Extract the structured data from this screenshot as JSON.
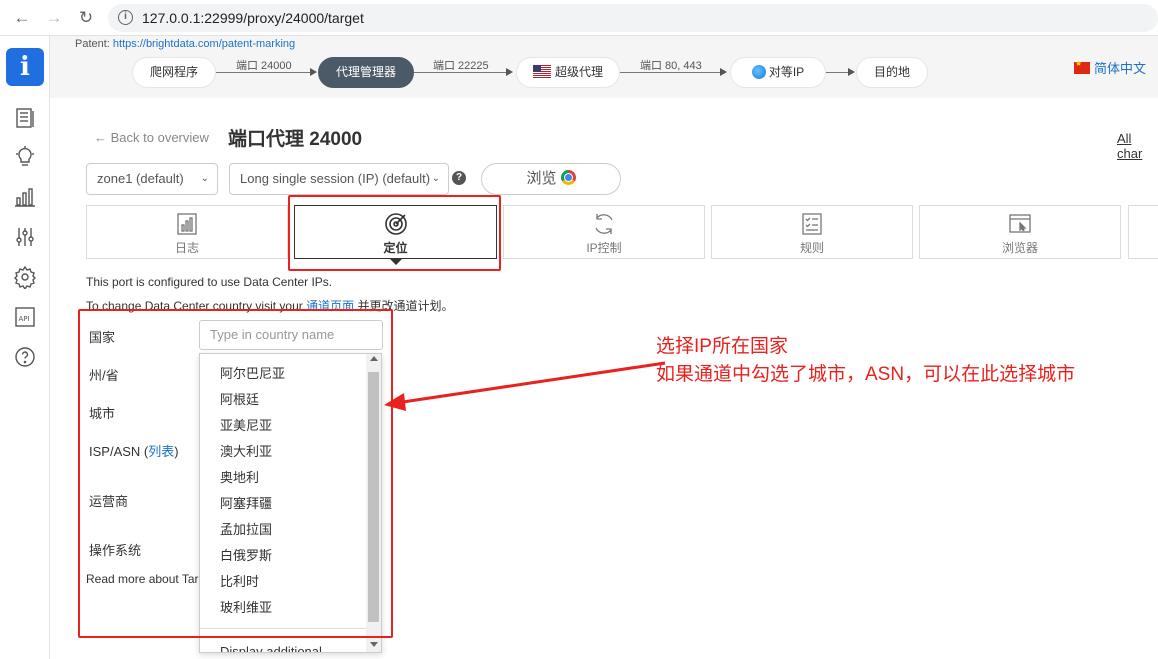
{
  "browser": {
    "url": "127.0.0.1:22999/proxy/24000/target"
  },
  "flow": {
    "patent_label": "Patent:",
    "patent_link": "https://brightdata.com/patent-marking",
    "crawler": "爬网程序",
    "port1": "端口 24000",
    "proxy_manager": "代理管理器",
    "port2": "端口 22225",
    "super_proxy": "超级代理",
    "port3": "端口 80, 443",
    "peer_ip": "对等IP",
    "destination": "目的地",
    "language": "简体中文"
  },
  "header": {
    "back": "Back to overview",
    "title": "端口代理 24000",
    "all_changes": "All char"
  },
  "controls": {
    "zone": "zone1 (default)",
    "session": "Long single session (IP) (default)",
    "browse": "浏览"
  },
  "tabs": [
    {
      "label": "日志",
      "icon": "chart-icon"
    },
    {
      "label": "定位",
      "icon": "target-icon"
    },
    {
      "label": "IP控制",
      "icon": "refresh-icon"
    },
    {
      "label": "规则",
      "icon": "rules-icon"
    },
    {
      "label": "浏览器",
      "icon": "browser-icon"
    }
  ],
  "info": {
    "line1": "This port is configured to use Data Center IPs.",
    "line2_pre": "To change Data Center country visit your ",
    "line2_link": "通道页面",
    "line2_post": " 并更改通道计划。"
  },
  "form": {
    "country_label": "国家",
    "country_placeholder": "Type in country name",
    "state_label": "州/省",
    "city_label": "城市",
    "isp_label": "ISP/ASN (",
    "isp_link": "列表",
    "isp_close": ")",
    "carrier_label": "运营商",
    "os_label": "操作系统",
    "read_more": "Read more about Tar"
  },
  "dropdown": {
    "options": [
      "阿尔巴尼亚",
      "阿根廷",
      "亚美尼亚",
      "澳大利亚",
      "奥地利",
      "阿塞拜疆",
      "孟加拉国",
      "白俄罗斯",
      "比利时",
      "玻利维亚"
    ],
    "more": "Display additional"
  },
  "annotation": {
    "line1": "选择IP所在国家",
    "line2": "如果通道中勾选了城市，ASN，可以在此选择城市"
  },
  "colors": {
    "accent": "#1f6fe0",
    "annotation_red": "#e8221e",
    "dark_pill": "#4c5a68"
  }
}
